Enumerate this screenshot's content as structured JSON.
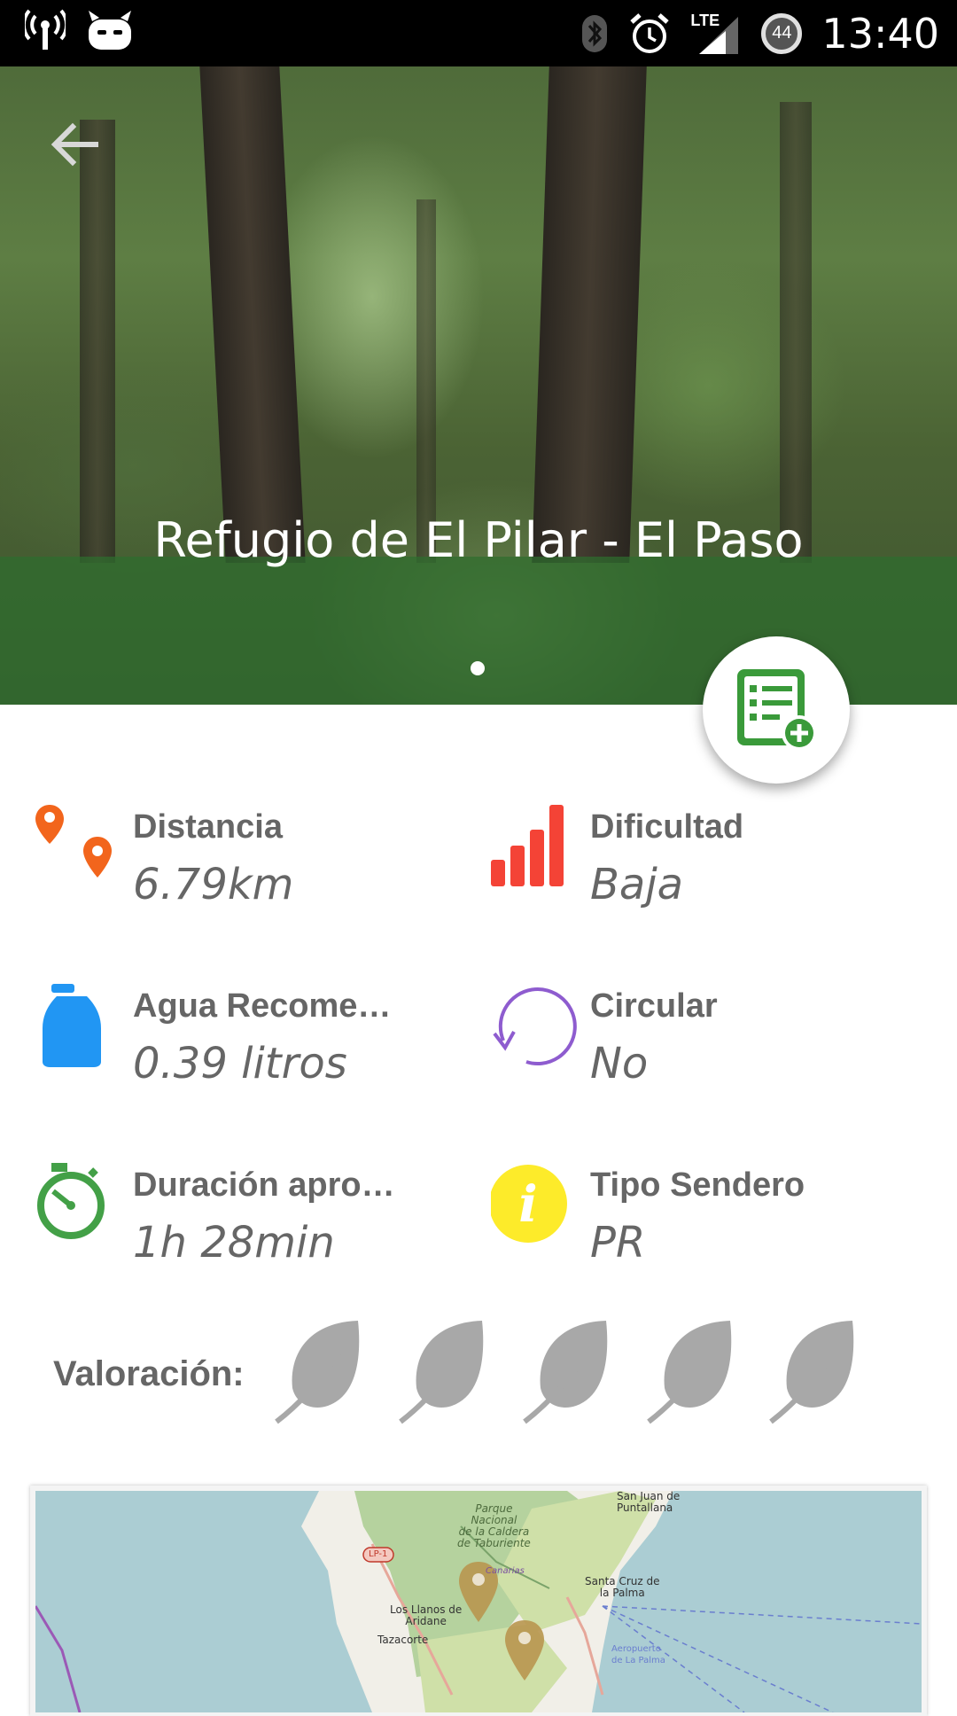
{
  "status_bar": {
    "time": "13:40",
    "battery_level": "44",
    "network_type": "LTE",
    "icons": [
      "wireless-signal-icon",
      "cyanogenmod-icon",
      "bluetooth-icon",
      "alarm-icon",
      "lte-signal-icon",
      "battery-icon"
    ]
  },
  "hero": {
    "title": "Refugio de El Pilar - El Paso",
    "band_color": "#2e6e2e"
  },
  "info": {
    "distance": {
      "label": "Distancia",
      "value": "6.79km",
      "icon": "map-pins-icon"
    },
    "difficulty": {
      "label": "Dificultad",
      "value": "Baja",
      "icon": "difficulty-bars-icon"
    },
    "water": {
      "label": "Agua Recomendada",
      "value": "0.39 litros",
      "icon": "water-bottle-icon"
    },
    "circular": {
      "label": "Circular",
      "value": "No",
      "icon": "circular-arrow-icon"
    },
    "duration": {
      "label": "Duración aproximada",
      "value": "1h 28min",
      "icon": "stopwatch-icon"
    },
    "trail_type": {
      "label": "Tipo Sendero",
      "value": "PR",
      "icon": "info-icon"
    }
  },
  "rating": {
    "label": "Valoración:",
    "max": 5,
    "value": 0,
    "icon": "leaf-icon"
  },
  "map": {
    "labels": {
      "park": "Parque\nNacional\nde la Caldera\nde Taburiente",
      "san_juan": "San Juan de\nPuntallana",
      "santa_cruz": "Santa Cruz de\nla Palma",
      "los_llanos": "Los Llanos de\nAridane",
      "tazacorte": "Tazacorte",
      "road": "LP-1",
      "airport": "Aeropuerto\nde La Palma",
      "canarias": "Canarias"
    }
  },
  "colors": {
    "accent_green": "#3a9a3a",
    "text_gray": "#666666",
    "pin_orange": "#f2651c",
    "bars_red": "#f44336",
    "water_blue": "#2196f3",
    "circular_purple": "#8e5ccf",
    "stopwatch_green": "#43a047",
    "info_yellow": "#fdeb2a",
    "leaf_gray": "#a8a8a8"
  }
}
